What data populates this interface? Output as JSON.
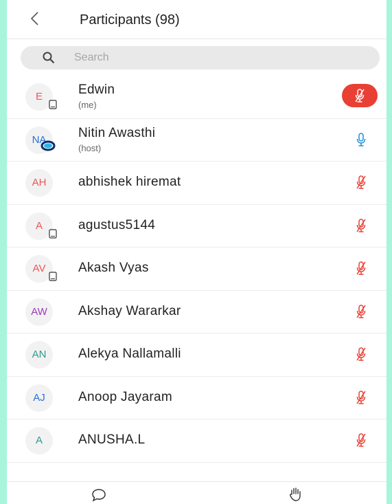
{
  "header": {
    "title": "Participants (98)"
  },
  "search": {
    "placeholder": "Search"
  },
  "participants": [
    {
      "initials": "E",
      "name": "Edwin",
      "sub": "(me)",
      "initials_color": "#e55",
      "device": "phone",
      "mic": "muted-active"
    },
    {
      "initials": "NA",
      "name": "Nitin Awasthi",
      "sub": "(host)",
      "initials_color": "#2a6fd6",
      "device": "logo",
      "mic": "on"
    },
    {
      "initials": "AH",
      "name": "abhishek hiremat",
      "sub": "",
      "initials_color": "#e55",
      "device": "",
      "mic": "muted"
    },
    {
      "initials": "A",
      "name": "agustus5144",
      "sub": "",
      "initials_color": "#e55",
      "device": "phone",
      "mic": "muted"
    },
    {
      "initials": "AV",
      "name": "Akash Vyas",
      "sub": "",
      "initials_color": "#e55",
      "device": "phone",
      "mic": "muted"
    },
    {
      "initials": "AW",
      "name": "Akshay Wararkar",
      "sub": "",
      "initials_color": "#9a3db8",
      "device": "",
      "mic": "muted"
    },
    {
      "initials": "AN",
      "name": "Alekya Nallamalli",
      "sub": "",
      "initials_color": "#2f9a8f",
      "device": "",
      "mic": "muted"
    },
    {
      "initials": "AJ",
      "name": "Anoop Jayaram",
      "sub": "",
      "initials_color": "#2a6fd6",
      "device": "",
      "mic": "muted"
    },
    {
      "initials": "A",
      "name": "ANUSHA.L",
      "sub": "",
      "initials_color": "#2f9a8f",
      "device": "",
      "mic": "muted"
    }
  ],
  "colors": {
    "muted": "#e84034",
    "on": "#1a8fe0",
    "background": "#a8f5dc"
  },
  "footer": {
    "icons": [
      "chat-icon",
      "raise-hand-icon"
    ]
  }
}
